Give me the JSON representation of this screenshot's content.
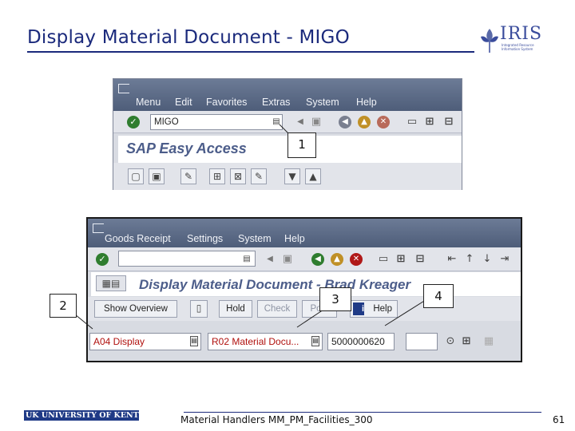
{
  "slide": {
    "title": "Display Material Document - MIGO",
    "logo_text": "IRIS",
    "logo_sub": "Integrated Resource Information System",
    "footer_logo": "UK UNIVERSITY OF KENTUCKY",
    "footer_text": "Material Handlers MM_PM_Facilities_300",
    "page_number": "61"
  },
  "window1": {
    "menu": [
      "Menu",
      "Edit",
      "Favorites",
      "Extras",
      "System",
      "Help"
    ],
    "command_value": "MIGO",
    "title": "SAP Easy Access"
  },
  "window2": {
    "menu": [
      "Goods Receipt",
      "Settings",
      "System",
      "Help"
    ],
    "command_value": "",
    "title": "Display Material Document - Brad Kreager",
    "buttons": {
      "show_overview": "Show Overview",
      "hold": "Hold",
      "check": "Check",
      "post": "Post",
      "help": "Help"
    },
    "action_select": "A04 Display",
    "reference_select": "R02 Material Docu...",
    "document_number": "5000000620",
    "year_value": ""
  },
  "callouts": [
    "1",
    "2",
    "3",
    "4"
  ],
  "colors": {
    "title": "#1b2a7c",
    "menubar": "#5a6986",
    "field_text": "#b0100d"
  }
}
